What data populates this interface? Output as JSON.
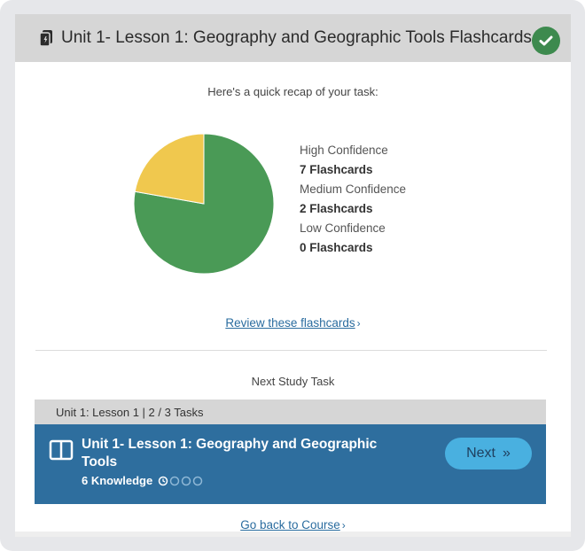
{
  "header": {
    "title": "Unit 1- Lesson 1: Geography and Geographic Tools Flashcards",
    "icon": "flashcard-deck-icon",
    "status_icon": "check-icon",
    "status_color": "#3d8a4e"
  },
  "recap": {
    "intro": "Here's a quick recap of your task:"
  },
  "chart_data": {
    "type": "pie",
    "categories": [
      "High Confidence",
      "Medium Confidence",
      "Low Confidence"
    ],
    "values": [
      7,
      2,
      0
    ],
    "colors": [
      "#4a9a56",
      "#f0c84e",
      "#d9534f"
    ],
    "legend_placement": "right"
  },
  "legend": [
    {
      "label": "High Confidence",
      "count": "7 Flashcards"
    },
    {
      "label": "Medium Confidence",
      "count": "2 Flashcards"
    },
    {
      "label": "Low Confidence",
      "count": "0 Flashcards"
    }
  ],
  "links": {
    "review": "Review these flashcards",
    "go_back": "Go back to Course"
  },
  "next_task": {
    "section_label": "Next Study Task",
    "meta": "Unit 1: Lesson 1 | 2 / 3 Tasks",
    "title": "Unit 1- Lesson 1: Geography and Geographic Tools",
    "knowledge": "6 Knowledge",
    "knowledge_progress": 0.25,
    "button_label": "Next",
    "button_icon": "double-chevron-right-icon",
    "bar_color": "#2e6e9e",
    "button_color": "#49b0e0"
  }
}
